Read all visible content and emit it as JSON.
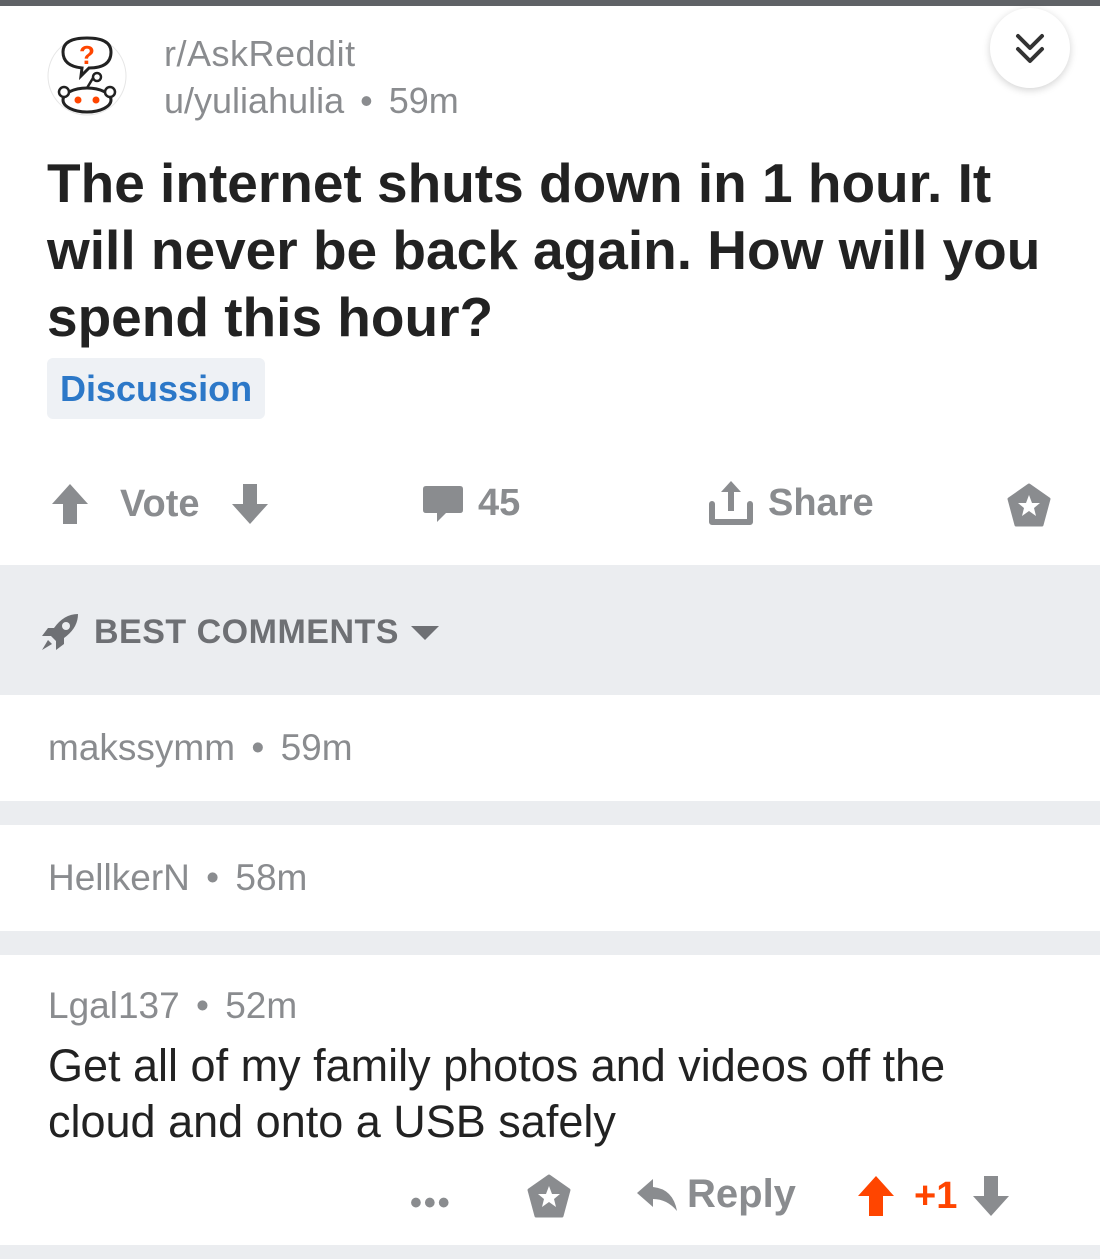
{
  "post": {
    "subreddit": "r/AskReddit",
    "author": "u/yuliahulia",
    "time": "59m",
    "title": "The internet shuts down in 1 hour. It will never be back again. How will you spend this hour?",
    "flair": "Discussion"
  },
  "actions": {
    "vote_label": "Vote",
    "comment_count": "45",
    "share_label": "Share"
  },
  "sort": {
    "label": "BEST COMMENTS"
  },
  "comments": [
    {
      "author": "makssymm",
      "time": "59m",
      "body": ""
    },
    {
      "author": "HellkerN",
      "time": "58m",
      "body": ""
    },
    {
      "author": "Lgal137",
      "time": "52m",
      "body": "Get all of my family photos and videos off the cloud and onto a USB safely",
      "reply_label": "Reply",
      "score": "+1"
    }
  ],
  "separator": "•",
  "colors": {
    "accent_blue": "#2c78c8",
    "upvote_orange": "#ff4500",
    "muted_gray": "#8a8c8f"
  }
}
